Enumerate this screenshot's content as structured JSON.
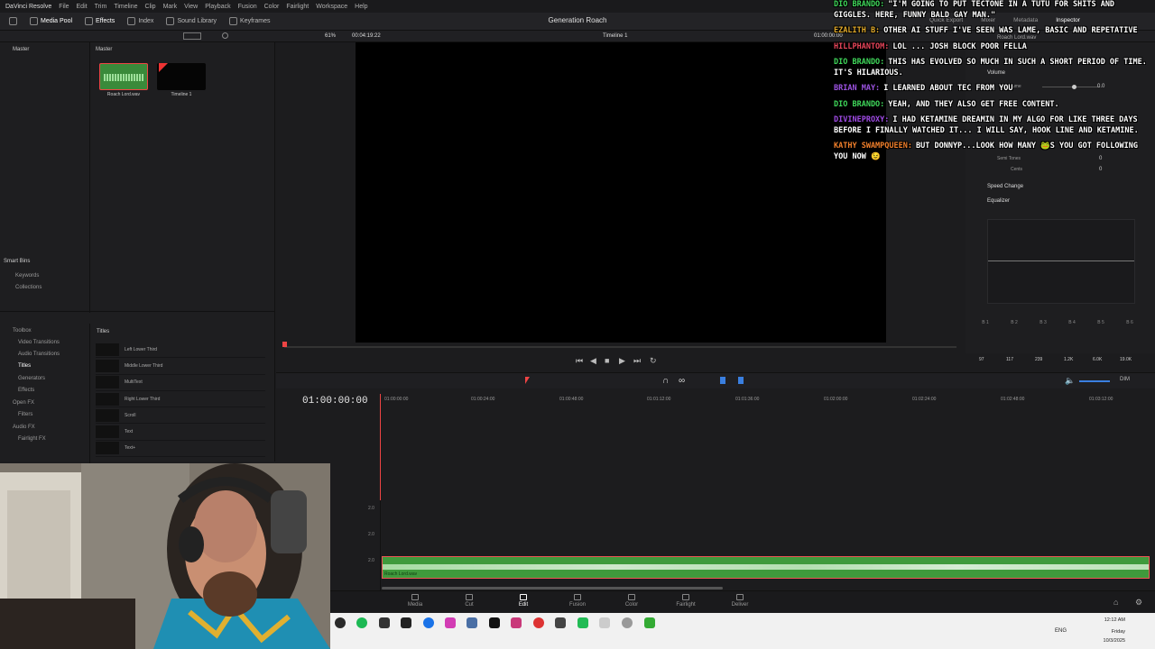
{
  "app": {
    "name": "DaVinci Resolve",
    "menus": [
      "File",
      "Edit",
      "Trim",
      "Timeline",
      "Clip",
      "Mark",
      "View",
      "Playback",
      "Fusion",
      "Color",
      "Fairlight",
      "Workspace",
      "Help"
    ]
  },
  "toolbar": {
    "items": [
      "Media Pool",
      "Effects",
      "Index",
      "Sound Library",
      "Keyframes"
    ],
    "right_items": [
      "Quick Export",
      "Mixer",
      "Metadata",
      "Inspector"
    ]
  },
  "project_title": "Generation Roach",
  "viewer": {
    "zoom": "61%",
    "timecode_left": "00:04:19:22",
    "timeline_name": "Timeline 1",
    "timecode_right": "01:00:00:00"
  },
  "media_pool": {
    "bin_header": "Master",
    "panel_header": "Master",
    "clips": [
      {
        "name": "Roach Lord.wav",
        "type": "audio"
      },
      {
        "name": "Timeline 1",
        "type": "timeline"
      }
    ],
    "smart_bins_label": "Smart Bins",
    "smart_bins": [
      "Keywords",
      "Collections"
    ]
  },
  "effects": {
    "tree": [
      "Toolbox",
      "Video Transitions",
      "Audio Transitions",
      "Titles",
      "Generators",
      "Effects",
      "Open FX",
      "Filters",
      "Audio FX",
      "Fairlight FX"
    ],
    "selected": "Titles",
    "list_header": "Titles",
    "items": [
      "Left Lower Third",
      "Middle Lower Third",
      "MultiText",
      "Right Lower Third",
      "Scroll",
      "Text",
      "Text+"
    ]
  },
  "inspector": {
    "clip_name": "Roach Lord.wav",
    "sections": [
      "Volume",
      "Speed Change",
      "Equalizer"
    ],
    "volume_label": "Volume",
    "volume_value": "0.0",
    "semi_tones_label": "Semi Tones",
    "semi_tones_value": "0",
    "cents_label": "Cents",
    "cents_value": "0",
    "eq_bands": [
      "B 1",
      "B 2",
      "B 3",
      "B 4",
      "B 5",
      "B 6"
    ],
    "eq_values": [
      "97",
      "117",
      "239",
      "1.2K",
      "6.0K",
      "19.0K"
    ]
  },
  "timeline": {
    "timecode": "01:00:00:00",
    "ruler_marks": [
      "01:00:00:00",
      "01:00:24:00",
      "01:00:48:00",
      "01:01:12:00",
      "01:01:36:00",
      "01:02:00:00",
      "01:02:24:00",
      "01:02:48:00",
      "01:03:12:00"
    ],
    "audio_clip": "Roach Lord.wav",
    "track_levels": [
      "2.0",
      "2.0",
      "2.0"
    ],
    "dim_label": "DIM"
  },
  "pages": [
    {
      "label": "Media",
      "active": false
    },
    {
      "label": "Cut",
      "active": false
    },
    {
      "label": "Edit",
      "active": true
    },
    {
      "label": "Fusion",
      "active": false
    },
    {
      "label": "Color",
      "active": false
    },
    {
      "label": "Fairlight",
      "active": false
    },
    {
      "label": "Deliver",
      "active": false
    }
  ],
  "taskbar": {
    "lang": "ENG",
    "time": "12:12 AM",
    "day": "Friday",
    "date": "10/3/2025"
  },
  "chat": [
    {
      "name": "Dio Brando:",
      "color": "#3fd65a",
      "text": "\"I'm going to put Tectone in a Tutu for shits and giggles. Here, funny bald gay man.\""
    },
    {
      "name": "Ezalith B:",
      "color": "#e0a92b",
      "text": "Other AI stuff I've seen was lame, basic and repetative"
    },
    {
      "name": "HillPhantom:",
      "color": "#e8455a",
      "text": "LOL ... JOSH BLOCK poor fella"
    },
    {
      "name": "Dio Brando:",
      "color": "#3fd65a",
      "text": "This has evolved so much in such a short period of time. It's hilarious."
    },
    {
      "name": "Brian May:",
      "color": "#9b52e0",
      "text": "I learned about Tec from you"
    },
    {
      "name": "Dio Brando:",
      "color": "#3fd65a",
      "text": "Yeah, and they also get free content."
    },
    {
      "name": "DivineProxy:",
      "color": "#a04be6",
      "text": "I had ketamine dreamin in my algo for like three days before I finally watched it... I will say, hook line and ketamine."
    },
    {
      "name": "Kathy SwampQueen:",
      "color": "#f07f2b",
      "text": "But DonnyP...look how many 🐸s you got following you now 😉"
    }
  ]
}
